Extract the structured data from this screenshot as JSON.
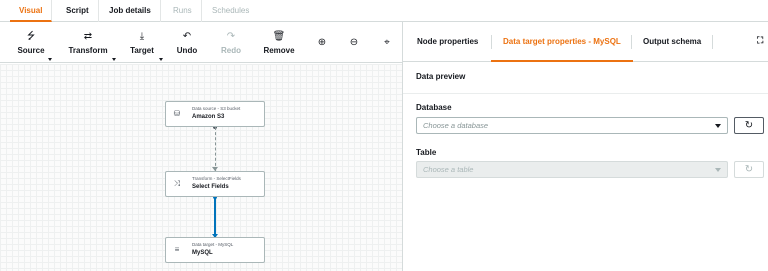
{
  "tabs": [
    {
      "label": "Visual",
      "state": "active"
    },
    {
      "label": "Script",
      "state": "normal"
    },
    {
      "label": "Job details",
      "state": "normal"
    },
    {
      "label": "Runs",
      "state": "disabled"
    },
    {
      "label": "Schedules",
      "state": "disabled"
    }
  ],
  "toolbar": {
    "source": {
      "label": "Source",
      "icon": "source-icon"
    },
    "transform": {
      "label": "Transform",
      "icon": "transform-icon"
    },
    "target": {
      "label": "Target",
      "icon": "target-icon"
    },
    "undo": {
      "label": "Undo",
      "icon": "undo-icon"
    },
    "redo": {
      "label": "Redo",
      "icon": "redo-icon",
      "disabled": true
    },
    "remove": {
      "label": "Remove",
      "icon": "trash-icon"
    },
    "zoom_in": {
      "icon": "zoom-in-icon"
    },
    "zoom_out": {
      "icon": "zoom-out-icon"
    },
    "fit": {
      "icon": "fit-screen-icon"
    }
  },
  "nodes": [
    {
      "subtitle": "Data source - S3 bucket",
      "title": "Amazon S3",
      "icon": "s3-bucket-icon"
    },
    {
      "subtitle": "Transform - SelectFields",
      "title": "Select Fields",
      "icon": "shuffle-icon"
    },
    {
      "subtitle": "Data target - MySQL",
      "title": "MySQL",
      "icon": "database-icon"
    }
  ],
  "panel": {
    "tabs": [
      {
        "label": "Node properties",
        "state": "normal"
      },
      {
        "label": "Data target properties - MySQL",
        "state": "active"
      },
      {
        "label": "Output schema",
        "state": "normal"
      }
    ],
    "expand_icon": "expand-icon",
    "preview_label": "Data preview",
    "database": {
      "label": "Database",
      "placeholder": "Choose a database"
    },
    "table": {
      "label": "Table",
      "placeholder": "Choose a table",
      "disabled": true
    }
  },
  "colors": {
    "accent": "#ec7211",
    "edge": "#0073bb"
  }
}
